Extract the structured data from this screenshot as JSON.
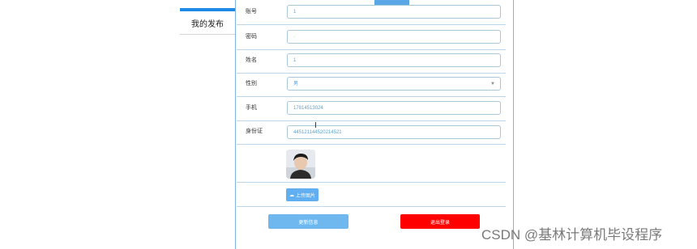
{
  "sidebar": {
    "items": [
      {
        "label": "我的发布"
      }
    ]
  },
  "form": {
    "username": {
      "label": "账号",
      "value": "1"
    },
    "password": {
      "label": "密码",
      "value": "·"
    },
    "name": {
      "label": "姓名",
      "value": "1"
    },
    "gender": {
      "label": "性别",
      "value": "男"
    },
    "phone": {
      "label": "手机",
      "value": "17814513024"
    },
    "idcard": {
      "label": "身份证",
      "value": "445121144520214521"
    }
  },
  "buttons": {
    "upload": "上传图片",
    "update": "更新信息",
    "logout": "退出登录"
  },
  "watermark": "CSDN @基林计算机毕设程序",
  "colors": {
    "accent": "#1e88e5",
    "primary_button": "#6fb8ef",
    "danger_button": "#ff0000"
  }
}
